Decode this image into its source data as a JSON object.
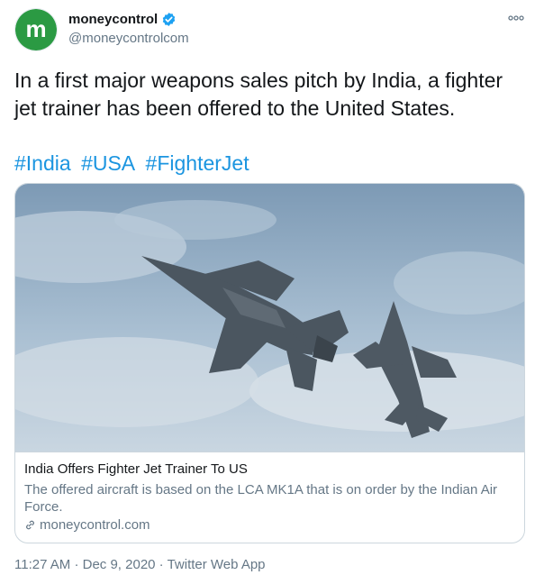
{
  "author": {
    "display_name": "moneycontrol",
    "handle": "@moneycontrolcom",
    "avatar_letter": "m",
    "verified": true,
    "brand_color": "#2b9a43"
  },
  "icons": {
    "more": "more-options-icon",
    "verified": "verified-badge-icon",
    "link": "link-icon"
  },
  "tweet": {
    "text": "In a first major weapons sales pitch by India, a fighter jet trainer has been offered to the United States.",
    "hashtags": [
      "#India",
      "#USA",
      "#FighterJet"
    ]
  },
  "card": {
    "title": "India Offers Fighter Jet Trainer To US",
    "description": "The offered aircraft is based on the LCA MK1A that is on order by the Indian Air Force.",
    "domain": "moneycontrol.com"
  },
  "meta": {
    "time": "11:27 AM",
    "date": "Dec 9, 2020",
    "source": "Twitter Web App",
    "separator": "·"
  },
  "colors": {
    "link": "#1b95e0",
    "secondary_text": "#657786",
    "primary_text": "#14171a",
    "border": "#ccd6dd",
    "verified": "#1da1f2"
  }
}
